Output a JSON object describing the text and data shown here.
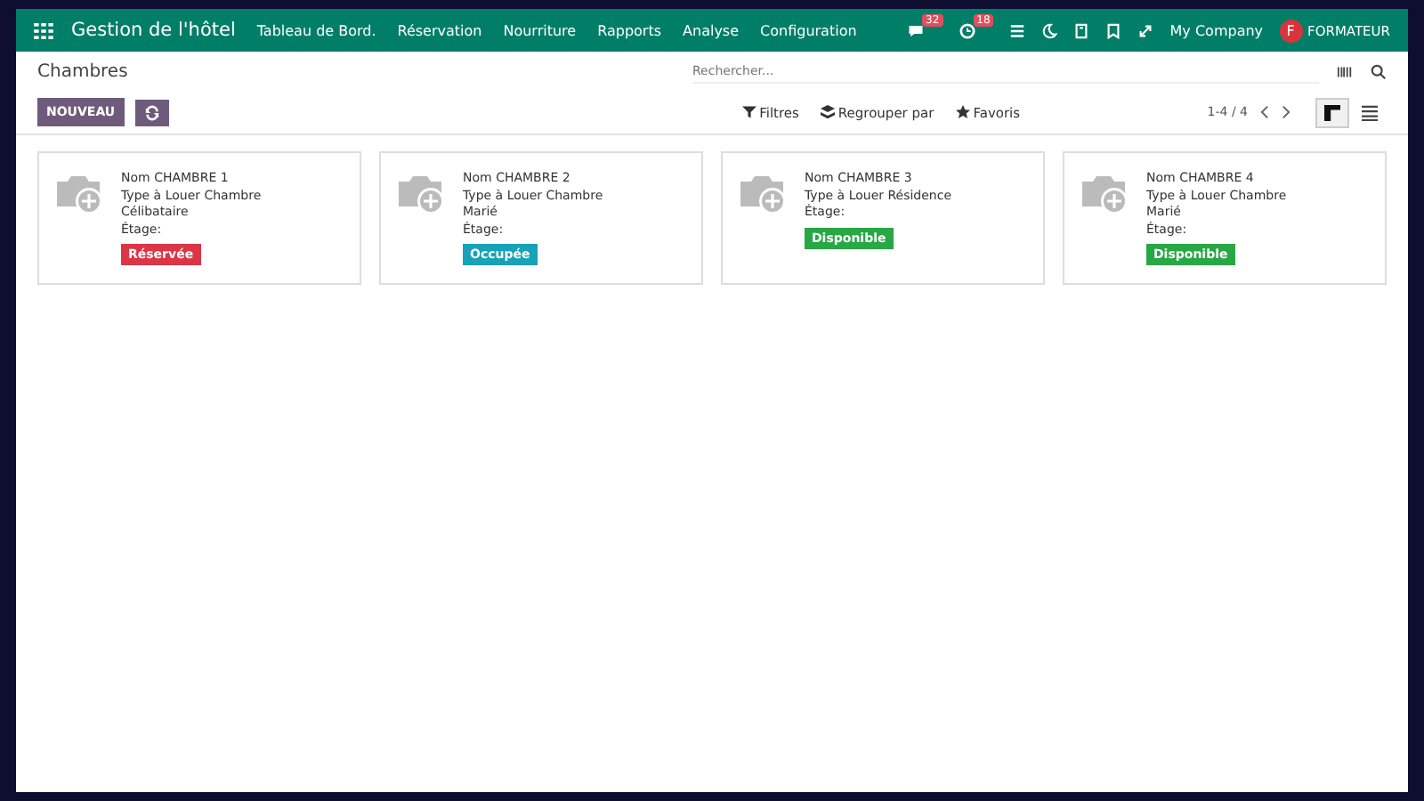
{
  "navbar": {
    "app_name": "Gestion de l'hôtel",
    "menu": [
      "Tableau de Bord.",
      "Réservation",
      "Nourriture",
      "Rapports",
      "Analyse",
      "Configuration"
    ],
    "messages_badge": "32",
    "activities_badge": "18",
    "company": "My Company",
    "user_initial": "F",
    "user_name": "FORMATEUR"
  },
  "control_panel": {
    "title": "Chambres",
    "new_button": "NOUVEAU",
    "search": {
      "placeholder": "Rechercher..."
    },
    "filters": [
      "Filtres",
      "Regrouper par",
      "Favoris"
    ],
    "pager": "1-4 / 4",
    "views": [
      {
        "kind": "kanban",
        "selected": true
      },
      {
        "kind": "list",
        "selected": false
      }
    ]
  },
  "cards": [
    {
      "lines": [
        "Nom CHAMBRE 1",
        "Type à Louer Chambre",
        "Célibataire",
        "Étage:"
      ],
      "status": "Réservée",
      "color": "#dc3545"
    },
    {
      "lines": [
        "Nom CHAMBRE 2",
        "Type à Louer Chambre",
        "Marié",
        "Étage:"
      ],
      "status": "Occupée",
      "color": "#17a2b8"
    },
    {
      "lines": [
        "Nom CHAMBRE 3",
        "Type à Louer Résidence",
        "Étage:"
      ],
      "status": "Disponible",
      "color": "#28a745"
    },
    {
      "lines": [
        "Nom CHAMBRE 4",
        "Type à Louer Chambre",
        "Marié",
        "Étage:"
      ],
      "status": "Disponible",
      "color": "#28a745"
    }
  ]
}
